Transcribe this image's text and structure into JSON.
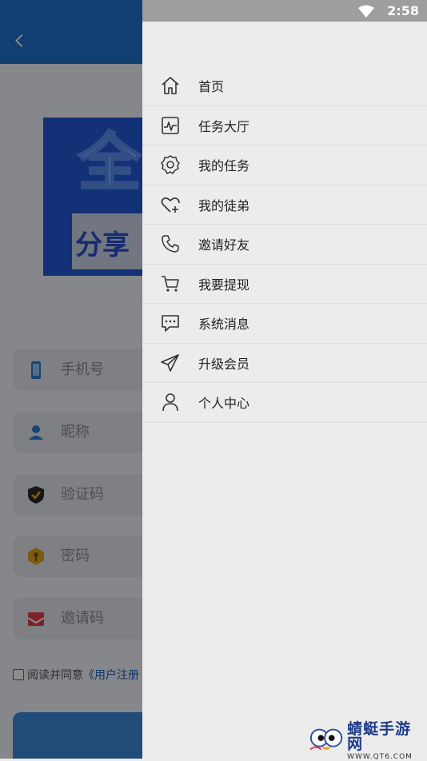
{
  "status_bar": {
    "time": "2:58",
    "wifi_icon": "wifi-icon"
  },
  "background_form": {
    "fields": [
      {
        "icon": "phone-icon",
        "label": "手机号"
      },
      {
        "icon": "user-icon",
        "label": "昵称"
      },
      {
        "icon": "shield-check-icon",
        "label": "验证码"
      },
      {
        "icon": "key-icon",
        "label": "密码"
      },
      {
        "icon": "mail-icon",
        "label": "邀请码"
      }
    ],
    "agreement_prefix": "阅读并同意",
    "agreement_link": "《用户注册",
    "banner_big": "全",
    "banner_sub": "分享"
  },
  "drawer": {
    "menu": [
      {
        "icon": "home-icon",
        "label": "首页"
      },
      {
        "icon": "activity-icon",
        "label": "任务大厅"
      },
      {
        "icon": "gear-icon",
        "label": "我的任务"
      },
      {
        "icon": "heart-plus-icon",
        "label": "我的徒弟"
      },
      {
        "icon": "phone-call-icon",
        "label": "邀请好友"
      },
      {
        "icon": "cart-icon",
        "label": "我要提现"
      },
      {
        "icon": "message-icon",
        "label": "系统消息"
      },
      {
        "icon": "send-icon",
        "label": "升级会员"
      },
      {
        "icon": "person-icon",
        "label": "个人中心"
      }
    ]
  },
  "watermark": {
    "title": "蜻蜓手游网",
    "url": "WWW.QT6.COM"
  },
  "colors": {
    "header": "#1f73cf",
    "drawer_bg": "#ececec",
    "link": "#1a5bbf"
  }
}
